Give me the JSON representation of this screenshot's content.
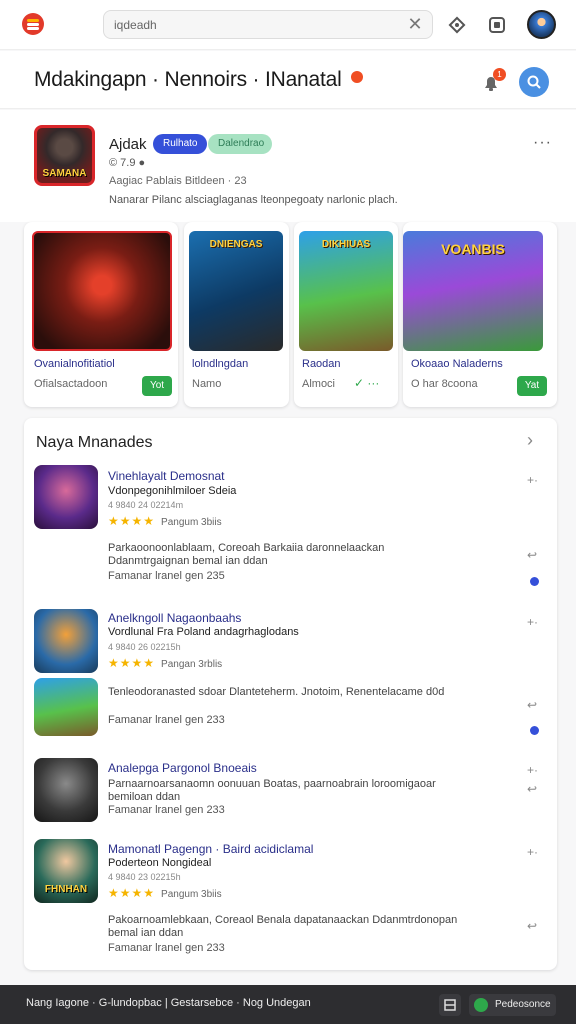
{
  "topbar": {
    "search_value": "iqdeadh",
    "icons": [
      "app-logo-icon",
      "clear-icon",
      "diamond-icon",
      "square-icon",
      "avatar"
    ]
  },
  "header": {
    "title": "Mdakingapn · Nennoirs · INanatal",
    "notif_count": "1"
  },
  "profile": {
    "name": "Ajdak",
    "chip1": "Rulhato",
    "chip2": "Dalendrao",
    "stats": "© 7.9  ●",
    "subline": "Aagiac Pablais Bitldeen · 23",
    "description": "Nanarar Pilanc alsciaglaganas lteonpegoaty narlonic plach.",
    "image_label": "SAMANA"
  },
  "cards": [
    {
      "title": "Ovanialnofitiatiol",
      "sub": "Ofialsactadoon",
      "button": "Yot",
      "art_label": ""
    },
    {
      "title": "lolndlngdan",
      "sub": "Namo",
      "button": "",
      "art_label": "DNIENGAS"
    },
    {
      "title": "Raodan",
      "sub": "Almoci",
      "button": "",
      "art_label": "DIKHIUAS"
    },
    {
      "title": "Okoaao Naladerns",
      "sub": "O har 8coona",
      "button": "Yat",
      "art_label": "VOANBIS"
    }
  ],
  "list": {
    "heading": "Naya Mnanades",
    "rows": [
      {
        "title": "Vinehlayalt Demosnat",
        "sub": "Vdonpegonihlmiloer Sdeia",
        "meta": "4 9840 24 02214m",
        "stars": "★★★★",
        "stars_note": "Pangum 3biis",
        "body": "Parkaoonoonlablaam, Coreoah Barkaiia daronnelaackan Ddanmtrgaignan   bemal ian ddan",
        "foot": "Famanar lranel gen 235",
        "img_label": ""
      },
      {
        "title": "Anelkngoll Nagaonbaahs",
        "sub": "Vordlunal Fra Poland andagrhaglodans",
        "meta": "4 9840 26 02215h",
        "stars": "★★★★",
        "stars_note": "Pangan 3rblis",
        "body": "",
        "foot": "",
        "img_label": ""
      },
      {
        "title": "",
        "sub": "",
        "meta": "",
        "stars": "",
        "stars_note": "",
        "body": "Tenleodoranasted sdoar Dlanteteherm. Jnotoim, Renentelacame   d0d",
        "foot": "Famanar lranel gen 233",
        "img_label": ""
      },
      {
        "title": "Analepga Pargonol Bnoeais",
        "sub": "",
        "meta": "",
        "stars": "",
        "stars_note": "",
        "body": "Parnaarnoarsanaomn oonuuan Boatas, paarnoabrain   loroomigaoar   bemiloan ddan",
        "foot": "Famanar lranel gen 233",
        "img_label": ""
      },
      {
        "title": "Mamonatl Pagengn · Baird acidiclamal",
        "sub": "Poderteon Nongideal",
        "meta": "4 9840 23 02215h",
        "stars": "★★★★",
        "stars_note": "Pangum 3biis",
        "body": "Pakoarnoamlebkaan, Coreaol Benala dapatanaackan Ddanmtrdonopan   bemal ian ddan",
        "foot": "Famanar lranel gen 233",
        "img_label": "FHNHAN"
      }
    ]
  },
  "bottom": {
    "text": "Nang Iagone · G-lundopbac | Gestarsebce · Nog Undegan",
    "button": "Pedeosonce"
  },
  "colors": {
    "accent": "#3550d9",
    "green": "#2ea84b",
    "red": "#e23a2a"
  }
}
